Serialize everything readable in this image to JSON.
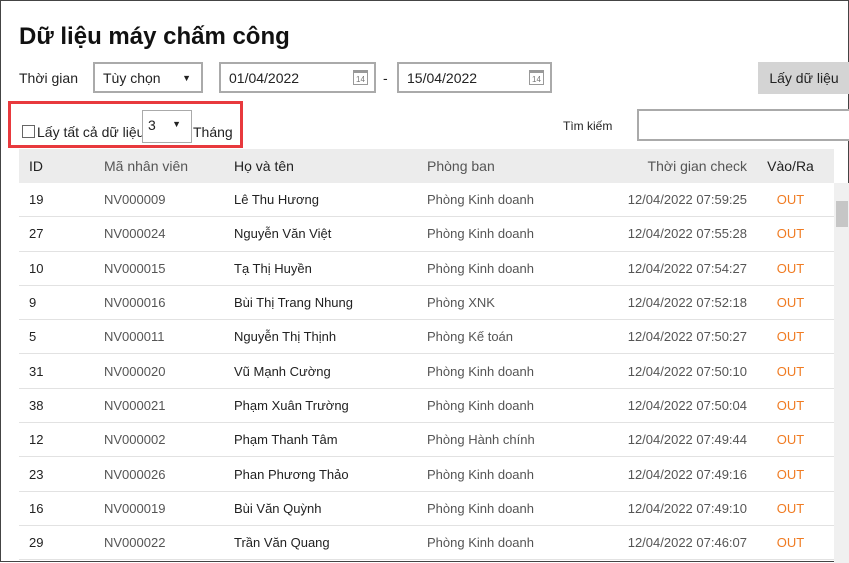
{
  "title": "Dữ liệu máy chấm công",
  "filters": {
    "time_label": "Thời gian",
    "time_mode": "Tùy chọn",
    "from_date": "01/04/2022",
    "to_date": "15/04/2022",
    "date_sep": "-",
    "fetch_button": "Lấy dữ liệu",
    "calendar_day": "14",
    "all_data_label": "Lấy tất cả dữ liệu",
    "all_data_checked": false,
    "months_value": "3",
    "months_unit": "Tháng",
    "search_label": "Tìm kiếm",
    "search_value": ""
  },
  "table": {
    "headers": [
      "ID",
      "Mã nhân viên",
      "Họ và tên",
      "Phòng ban",
      "Thời gian check",
      "Vào/Ra"
    ],
    "rows": [
      [
        "19",
        "NV000009",
        "Lê Thu Hương",
        "Phòng Kinh doanh",
        "12/04/2022 07:59:25",
        "OUT"
      ],
      [
        "27",
        "NV000024",
        "Nguyễn Văn Việt",
        "Phòng Kinh doanh",
        "12/04/2022 07:55:28",
        "OUT"
      ],
      [
        "10",
        "NV000015",
        "Tạ Thị Huyền",
        "Phòng Kinh doanh",
        "12/04/2022 07:54:27",
        "OUT"
      ],
      [
        "9",
        "NV000016",
        "Bùi Thị Trang Nhung",
        "Phòng XNK",
        "12/04/2022 07:52:18",
        "OUT"
      ],
      [
        "5",
        "NV000011",
        "Nguyễn Thị Thịnh",
        "Phòng Kế toán",
        "12/04/2022 07:50:27",
        "OUT"
      ],
      [
        "31",
        "NV000020",
        "Vũ Mạnh Cường",
        "Phòng Kinh doanh",
        "12/04/2022 07:50:10",
        "OUT"
      ],
      [
        "38",
        "NV000021",
        "Phạm Xuân Trường",
        "Phòng Kinh doanh",
        "12/04/2022 07:50:04",
        "OUT"
      ],
      [
        "12",
        "NV000002",
        "Phạm Thanh Tâm",
        "Phòng Hành chính",
        "12/04/2022 07:49:44",
        "OUT"
      ],
      [
        "23",
        "NV000026",
        "Phan Phương Thảo",
        "Phòng Kinh doanh",
        "12/04/2022 07:49:16",
        "OUT"
      ],
      [
        "16",
        "NV000019",
        "Bùi Văn Quỳnh",
        "Phòng Kinh doanh",
        "12/04/2022 07:49:10",
        "OUT"
      ],
      [
        "29",
        "NV000022",
        "Trần Văn Quang",
        "Phòng Kinh doanh",
        "12/04/2022 07:46:07",
        "OUT"
      ]
    ]
  },
  "colors": {
    "highlight": "#e8393d",
    "out": "#f07b22"
  }
}
